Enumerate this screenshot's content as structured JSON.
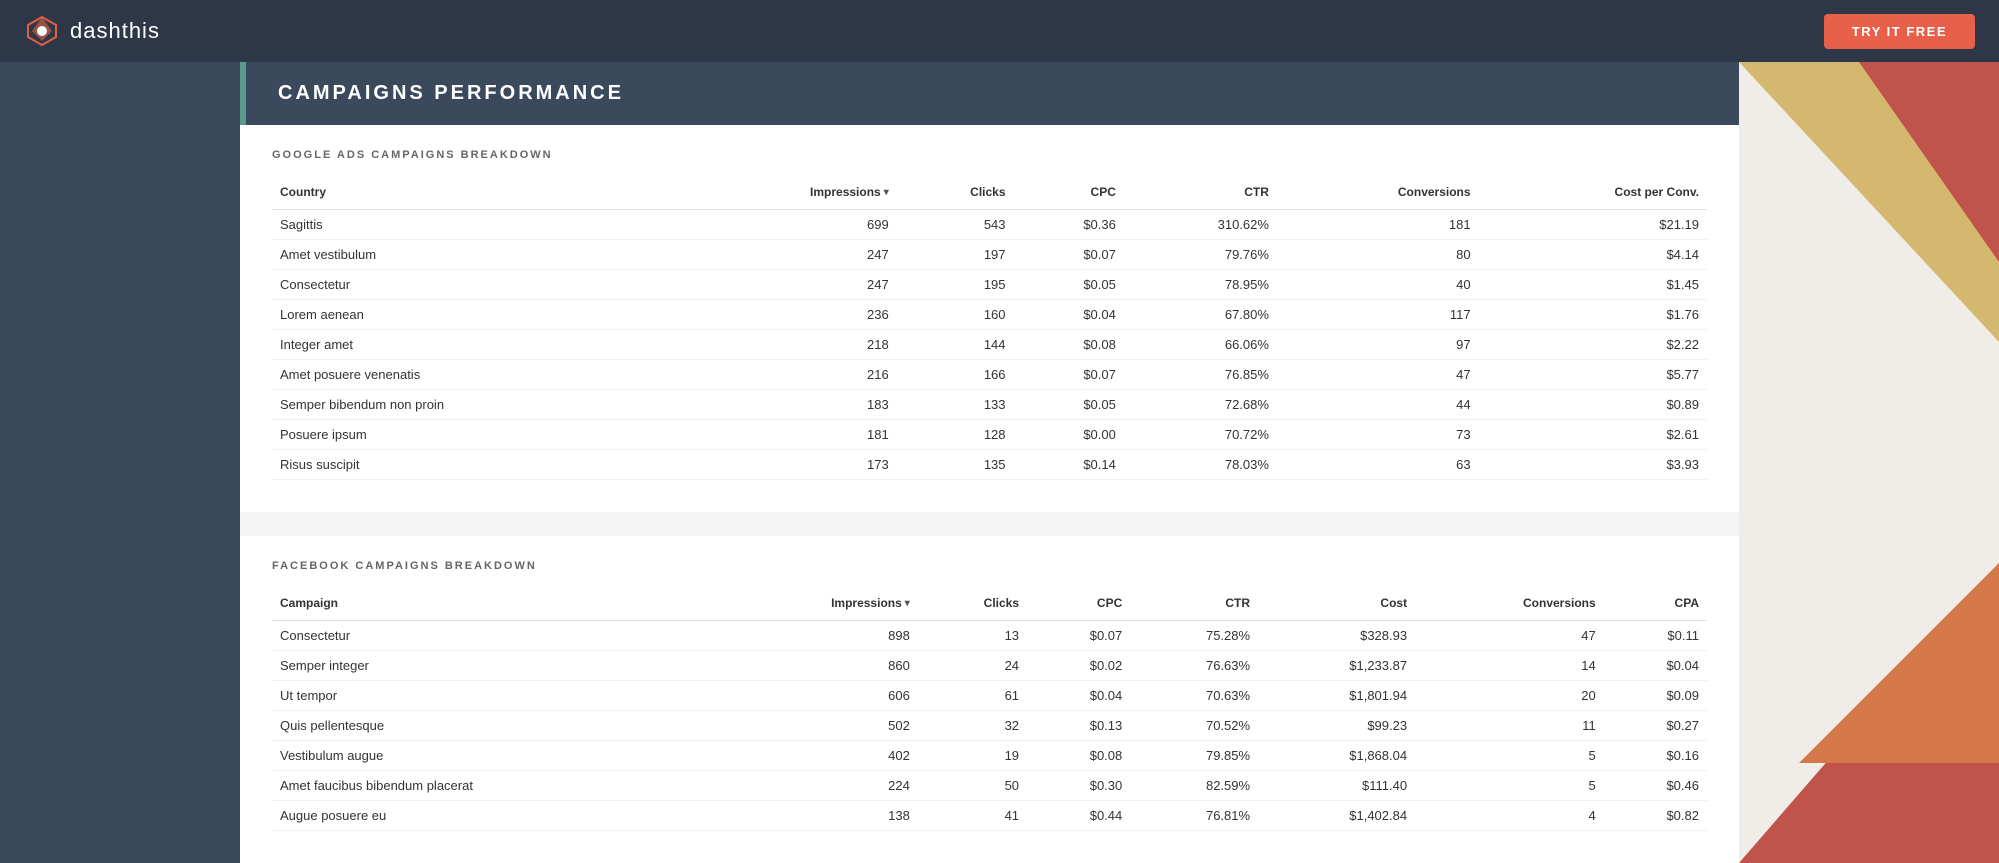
{
  "header": {
    "logo_text": "dashthis",
    "try_free_label": "TRY IT FREE"
  },
  "page_title": "CAMPAIGNS PERFORMANCE",
  "google_section": {
    "label": "GOOGLE ADS CAMPAIGNS BREAKDOWN",
    "columns": [
      "Country",
      "Impressions",
      "Clicks",
      "CPC",
      "CTR",
      "Conversions",
      "Cost per Conv."
    ],
    "rows": [
      {
        "country": "Sagittis",
        "impressions": "699",
        "clicks": "543",
        "cpc": "$0.36",
        "ctr": "310.62%",
        "conversions": "181",
        "cost_per_conv": "$21.19"
      },
      {
        "country": "Amet vestibulum",
        "impressions": "247",
        "clicks": "197",
        "cpc": "$0.07",
        "ctr": "79.76%",
        "conversions": "80",
        "cost_per_conv": "$4.14"
      },
      {
        "country": "Consectetur",
        "impressions": "247",
        "clicks": "195",
        "cpc": "$0.05",
        "ctr": "78.95%",
        "conversions": "40",
        "cost_per_conv": "$1.45"
      },
      {
        "country": "Lorem aenean",
        "impressions": "236",
        "clicks": "160",
        "cpc": "$0.04",
        "ctr": "67.80%",
        "conversions": "117",
        "cost_per_conv": "$1.76"
      },
      {
        "country": "Integer amet",
        "impressions": "218",
        "clicks": "144",
        "cpc": "$0.08",
        "ctr": "66.06%",
        "conversions": "97",
        "cost_per_conv": "$2.22"
      },
      {
        "country": "Amet posuere venenatis",
        "impressions": "216",
        "clicks": "166",
        "cpc": "$0.07",
        "ctr": "76.85%",
        "conversions": "47",
        "cost_per_conv": "$5.77"
      },
      {
        "country": "Semper bibendum non proin",
        "impressions": "183",
        "clicks": "133",
        "cpc": "$0.05",
        "ctr": "72.68%",
        "conversions": "44",
        "cost_per_conv": "$0.89"
      },
      {
        "country": "Posuere ipsum",
        "impressions": "181",
        "clicks": "128",
        "cpc": "$0.00",
        "ctr": "70.72%",
        "conversions": "73",
        "cost_per_conv": "$2.61"
      },
      {
        "country": "Risus suscipit",
        "impressions": "173",
        "clicks": "135",
        "cpc": "$0.14",
        "ctr": "78.03%",
        "conversions": "63",
        "cost_per_conv": "$3.93"
      }
    ]
  },
  "facebook_section": {
    "label": "FACEBOOK CAMPAIGNS BREAKDOWN",
    "columns": [
      "Campaign",
      "Impressions",
      "Clicks",
      "CPC",
      "CTR",
      "Cost",
      "Conversions",
      "CPA"
    ],
    "rows": [
      {
        "campaign": "Consectetur",
        "impressions": "898",
        "clicks": "13",
        "cpc": "$0.07",
        "ctr": "75.28%",
        "cost": "$328.93",
        "conversions": "47",
        "cpa": "$0.11"
      },
      {
        "campaign": "Semper integer",
        "impressions": "860",
        "clicks": "24",
        "cpc": "$0.02",
        "ctr": "76.63%",
        "cost": "$1,233.87",
        "conversions": "14",
        "cpa": "$0.04"
      },
      {
        "campaign": "Ut tempor",
        "impressions": "606",
        "clicks": "61",
        "cpc": "$0.04",
        "ctr": "70.63%",
        "cost": "$1,801.94",
        "conversions": "20",
        "cpa": "$0.09"
      },
      {
        "campaign": "Quis pellentesque",
        "impressions": "502",
        "clicks": "32",
        "cpc": "$0.13",
        "ctr": "70.52%",
        "cost": "$99.23",
        "conversions": "11",
        "cpa": "$0.27"
      },
      {
        "campaign": "Vestibulum augue",
        "impressions": "402",
        "clicks": "19",
        "cpc": "$0.08",
        "ctr": "79.85%",
        "cost": "$1,868.04",
        "conversions": "5",
        "cpa": "$0.16"
      },
      {
        "campaign": "Amet faucibus bibendum placerat",
        "impressions": "224",
        "clicks": "50",
        "cpc": "$0.30",
        "ctr": "82.59%",
        "cost": "$111.40",
        "conversions": "5",
        "cpa": "$0.46"
      },
      {
        "campaign": "Augue posuere eu",
        "impressions": "138",
        "clicks": "41",
        "cpc": "$0.44",
        "ctr": "76.81%",
        "cost": "$1,402.84",
        "conversions": "4",
        "cpa": "$0.82"
      }
    ]
  }
}
